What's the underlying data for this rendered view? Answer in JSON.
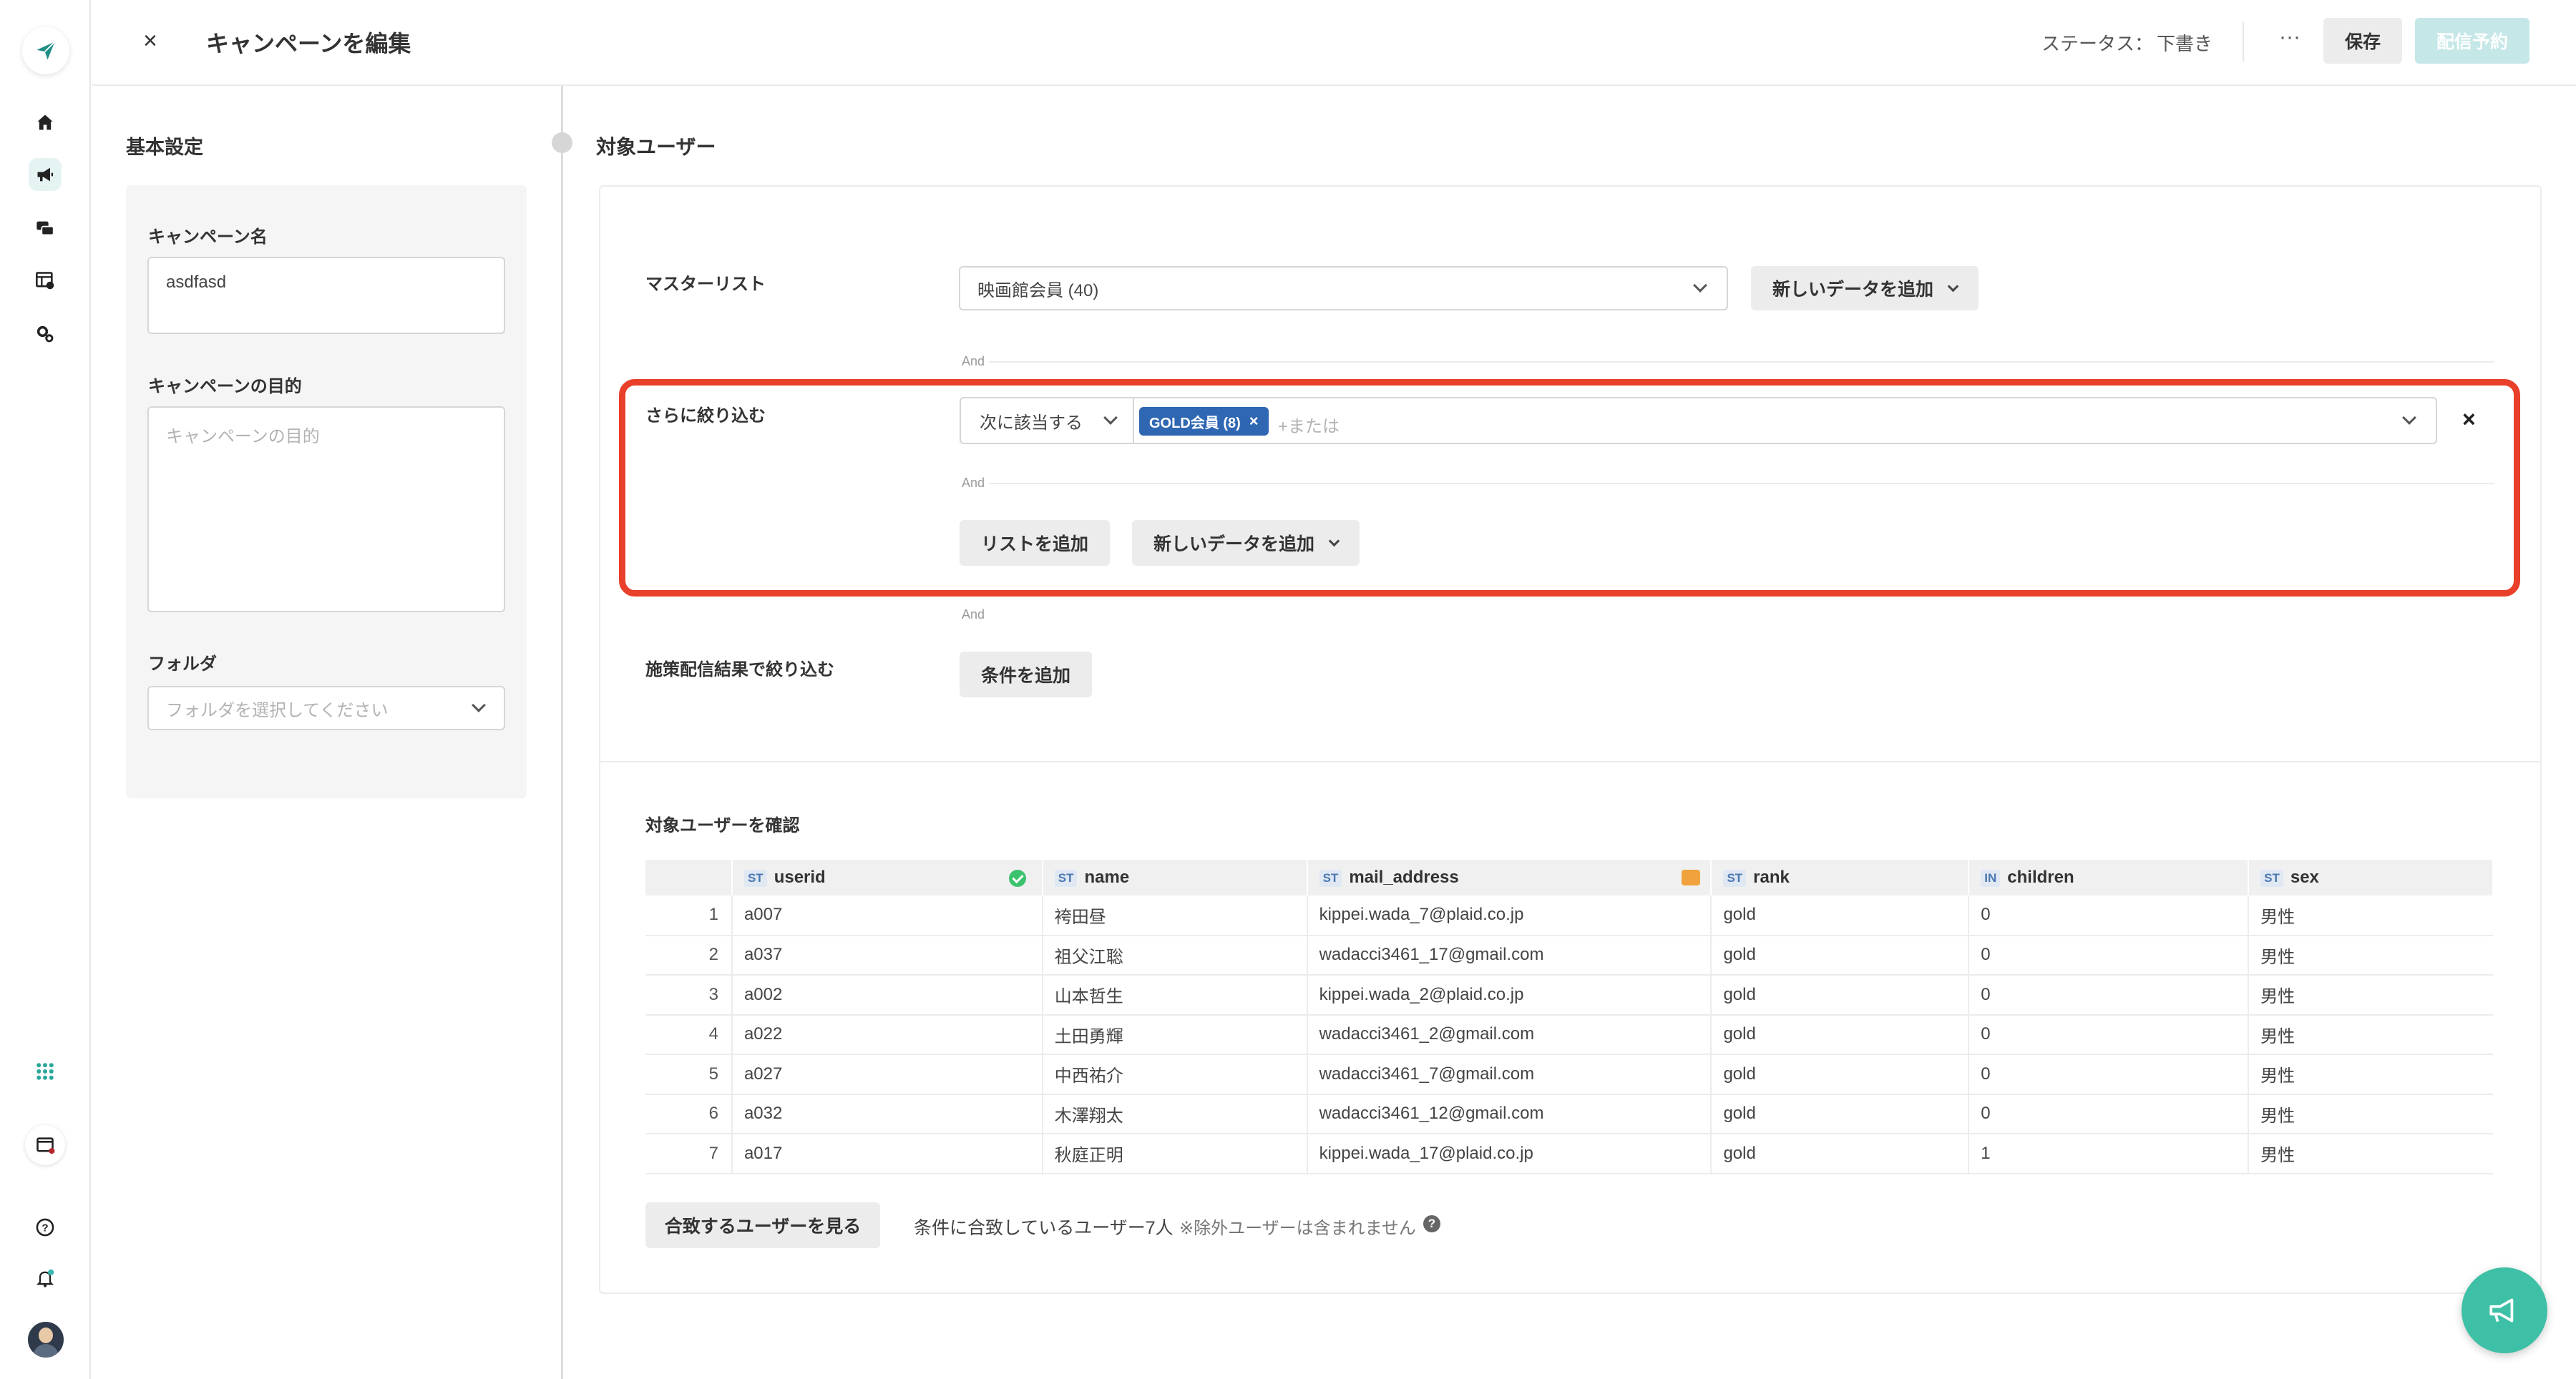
{
  "header": {
    "close_label": "×",
    "title": "キャンペーンを編集",
    "status_label": "ステータス：",
    "status_value": "下書き",
    "more_label": "···",
    "save_label": "保存",
    "schedule_label": "配信予約"
  },
  "sidebar": {
    "icons": [
      "send-logo-icon",
      "home-icon",
      "megaphone-icon",
      "message-icon",
      "table-icon",
      "settings-icon",
      "apps-grid-icon",
      "window-icon",
      "help-icon",
      "bell-icon"
    ]
  },
  "basic_settings": {
    "title": "基本設定",
    "campaign_name_label": "キャンペーン名",
    "campaign_name_value": "asdfasd",
    "purpose_label": "キャンペーンの目的",
    "purpose_placeholder": "キャンペーンの目的",
    "folder_label": "フォルダ",
    "folder_placeholder": "フォルダを選択してください"
  },
  "target_users": {
    "title": "対象ユーザー",
    "master_list_label": "マスターリスト",
    "master_list_value": "映画館会員 (40)",
    "add_data_label": "新しいデータを追加",
    "and_label": "And",
    "narrow_label": "さらに絞り込む",
    "match_mode": "次に該当する",
    "tag_label": "GOLD会員 (8)",
    "or_placeholder": "+または",
    "add_list_label": "リストを追加",
    "add_data_label_2": "新しいデータを追加",
    "delivery_filter_label": "施策配信結果で絞り込む",
    "add_condition_label": "条件を追加"
  },
  "confirm": {
    "title": "対象ユーザーを確認",
    "columns": [
      {
        "type": "",
        "name": ""
      },
      {
        "type": "ST",
        "name": "userid"
      },
      {
        "type": "ST",
        "name": "name"
      },
      {
        "type": "ST",
        "name": "mail_address"
      },
      {
        "type": "ST",
        "name": "rank"
      },
      {
        "type": "IN",
        "name": "children"
      },
      {
        "type": "ST",
        "name": "sex"
      }
    ],
    "rows": [
      [
        "1",
        "a007",
        "袴田昼",
        "kippei.wada_7@plaid.co.jp",
        "gold",
        "0",
        "男性"
      ],
      [
        "2",
        "a037",
        "祖父江聡",
        "wadacci3461_17@gmail.com",
        "gold",
        "0",
        "男性"
      ],
      [
        "3",
        "a002",
        "山本哲生",
        "kippei.wada_2@plaid.co.jp",
        "gold",
        "0",
        "男性"
      ],
      [
        "4",
        "a022",
        "土田勇輝",
        "wadacci3461_2@gmail.com",
        "gold",
        "0",
        "男性"
      ],
      [
        "5",
        "a027",
        "中西祐介",
        "wadacci3461_7@gmail.com",
        "gold",
        "0",
        "男性"
      ],
      [
        "6",
        "a032",
        "木澤翔太",
        "wadacci3461_12@gmail.com",
        "gold",
        "0",
        "男性"
      ],
      [
        "7",
        "a017",
        "秋庭正明",
        "kippei.wada_17@plaid.co.jp",
        "gold",
        "1",
        "男性"
      ]
    ],
    "match_button": "合致するユーザーを見る",
    "match_text": "条件に合致しているユーザー7人",
    "note_text": "※除外ユーザーは含まれません",
    "help_label": "?"
  },
  "colors": {
    "accent": "#3ec0a6",
    "highlight": "#e8402a",
    "tag": "#2f67b3"
  }
}
